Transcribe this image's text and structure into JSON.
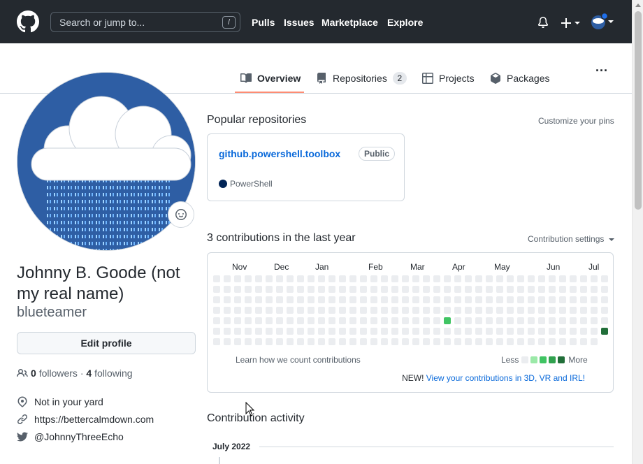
{
  "header": {
    "search_placeholder": "Search or jump to...",
    "search_shortcut": "/",
    "nav": [
      "Pulls",
      "Issues",
      "Marketplace",
      "Explore"
    ],
    "icons": [
      "github-logo",
      "bell-icon",
      "plus-icon",
      "avatar-menu"
    ]
  },
  "tabs": [
    {
      "label": "Overview",
      "icon": "book-icon",
      "active": true
    },
    {
      "label": "Repositories",
      "icon": "repo-icon",
      "count": "2"
    },
    {
      "label": "Projects",
      "icon": "table-icon"
    },
    {
      "label": "Packages",
      "icon": "package-icon"
    }
  ],
  "more_menu": "...",
  "profile": {
    "name": "Johnny B. Goode (not my real name)",
    "username": "blueteamer",
    "edit_label": "Edit profile",
    "followers_count": "0",
    "followers_label": "followers",
    "separator": "·",
    "following_count": "4",
    "following_label": "following",
    "location": "Not in your yard",
    "website": "https://bettercalmdown.com",
    "twitter": "@JohnnyThreeEcho"
  },
  "popular": {
    "heading": "Popular repositories",
    "customize": "Customize your pins",
    "repos": [
      {
        "name": "github.powershell.toolbox",
        "visibility": "Public",
        "language": "PowerShell",
        "language_color": "#012456"
      }
    ]
  },
  "contributions": {
    "heading": "3 contributions in the last year",
    "settings": "Contribution settings",
    "months": [
      "Nov",
      "Dec",
      "Jan",
      "Feb",
      "Mar",
      "Apr",
      "May",
      "Jun",
      "Jul"
    ],
    "weeks": 38,
    "last_week_days": 6,
    "active_cells": [
      {
        "week": 22,
        "day": 4,
        "level": 2
      },
      {
        "week": 37,
        "day": 5,
        "level": 4
      }
    ],
    "level_colors": [
      "#ebedf0",
      "#9be9a8",
      "#40c463",
      "#30a14e",
      "#216e39"
    ],
    "learn": "Learn how we count contributions",
    "less": "Less",
    "more": "More",
    "new_prefix": "NEW!",
    "new_link": "View your contributions in 3D, VR and IRL!"
  },
  "activity": {
    "heading": "Contribution activity",
    "month": "July 2022"
  }
}
